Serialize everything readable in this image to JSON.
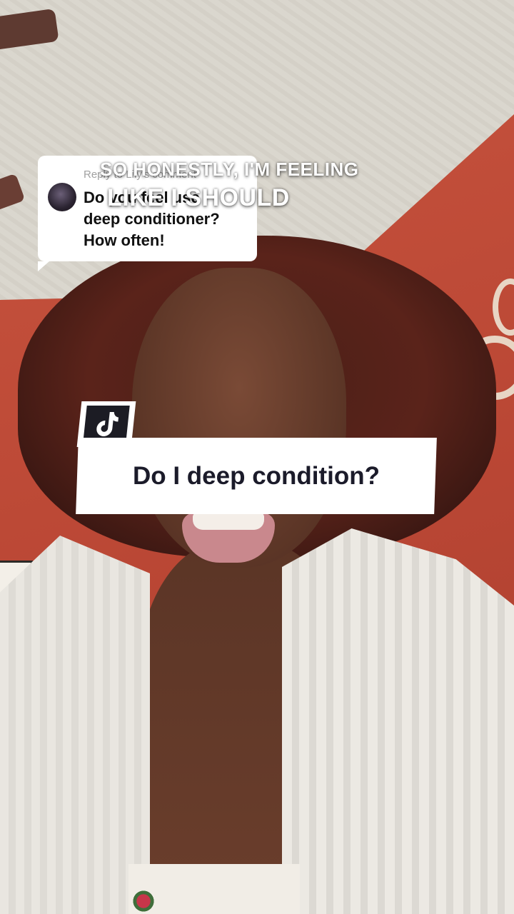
{
  "reply_card": {
    "header": "Reply to Lily's comment",
    "line1": "Do you feel use",
    "line2": "deep conditioner?",
    "line3": "How often!"
  },
  "caption": {
    "line1": "SO HONESTLY, I'M FEELING",
    "line2": "LIKE I SHOULD"
  },
  "topic_card": {
    "icon": "tiktok-logo-icon",
    "title": "Do I deep condition?"
  },
  "colors": {
    "wall": "#b94634",
    "hair": "#4a1f17",
    "card_bg": "#ffffff",
    "topic_text": "#1b1b2a"
  }
}
